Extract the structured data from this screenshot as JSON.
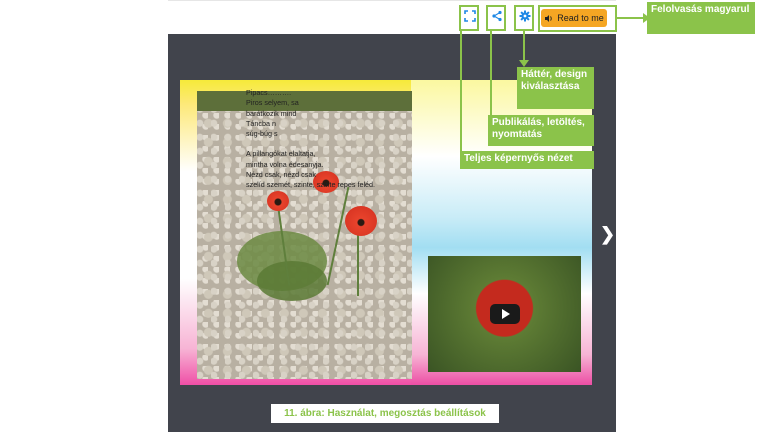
{
  "toolbar": {
    "read_to_me_label": "Read to me",
    "icons": [
      "fullscreen-icon",
      "share-icon",
      "gear-icon",
      "speaker-icon"
    ]
  },
  "poem": {
    "stanza1": [
      "Pipacs……….",
      "Piros selyem, sa",
      "barátkozik mind",
      "Táncba n",
      "súg-búg s"
    ],
    "stanza2": [
      "A pillangókat elaltatja,",
      "mintha volna édesanyja.",
      "Nézd csak, nézd csak",
      "szelíd szemét, szinte, szinte repes feléd."
    ]
  },
  "annotations": {
    "read_aloud": "Felolvasás magyarul",
    "background": "Háttér, design kiválasztása",
    "publish": "Publikálás, letöltés, nyomtatás",
    "fullscreen": "Teljes képernyős nézet"
  },
  "caption": "11. ábra: Használat, megosztás beállítások",
  "colors": {
    "accent_green": "#8bc34a",
    "stage_bg": "#41444c",
    "read_button": "#f5a623",
    "icon_blue": "#1e88e5"
  }
}
